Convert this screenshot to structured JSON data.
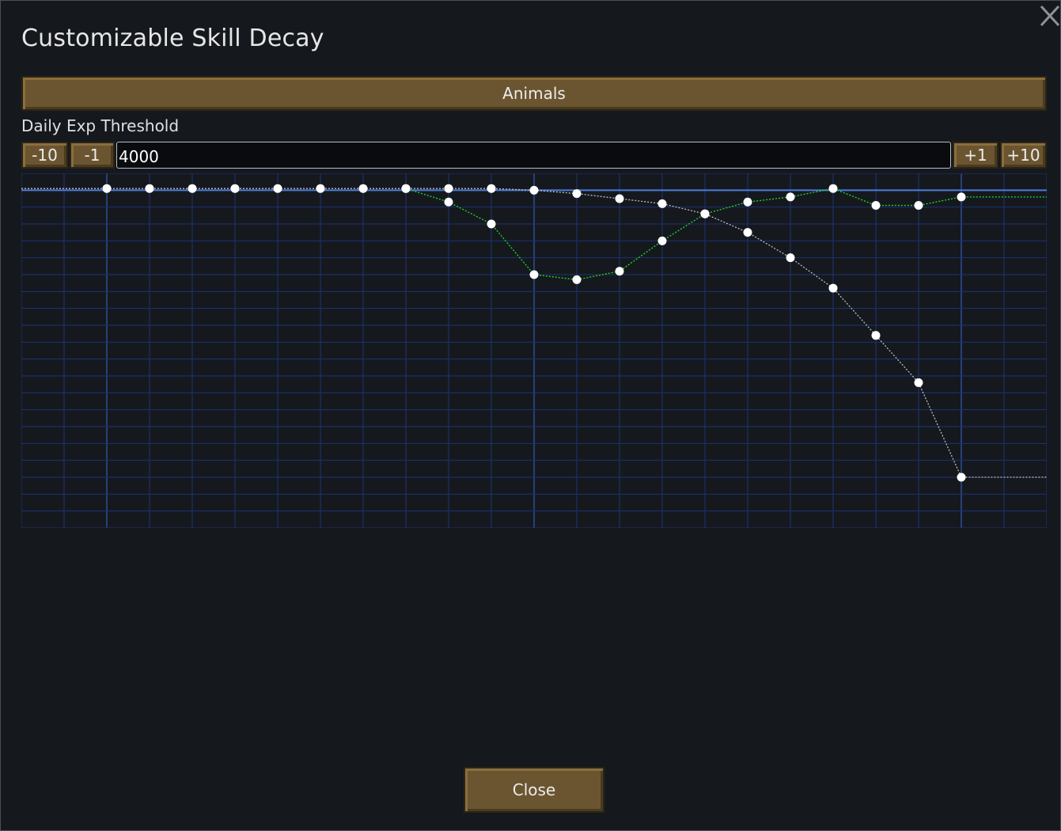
{
  "dialog": {
    "title": "Customizable Skill Decay",
    "close_icon": "close-x-icon"
  },
  "skill_selector": {
    "label": "Animals"
  },
  "threshold": {
    "label": "Daily Exp Threshold",
    "value": "4000",
    "buttons": {
      "minus10": "-10",
      "minus1": "-1",
      "plus1": "+1",
      "plus10": "+10"
    }
  },
  "footer": {
    "close_label": "Close"
  },
  "chart_data": {
    "type": "line",
    "grid": true,
    "xlim": [
      -2,
      22
    ],
    "ylim": [
      -20,
      1
    ],
    "x_major_lines": [
      0,
      10,
      20
    ],
    "reference_y": 0,
    "colors": {
      "grid": "#1e3275",
      "major": "#3454a8",
      "reference": "#4f7bdc",
      "series_decay": "#bdbdbd",
      "series_green": "#22dd22",
      "point": "#ffffff"
    },
    "series": [
      {
        "key": "decay",
        "points": [
          [
            0,
            0.1
          ],
          [
            1,
            0.1
          ],
          [
            2,
            0.1
          ],
          [
            3,
            0.1
          ],
          [
            4,
            0.1
          ],
          [
            5,
            0.1
          ],
          [
            6,
            0.1
          ],
          [
            7,
            0.1
          ],
          [
            8,
            0.1
          ],
          [
            9,
            0.1
          ],
          [
            10,
            0
          ],
          [
            11,
            -0.2
          ],
          [
            12,
            -0.5
          ],
          [
            13,
            -0.8
          ],
          [
            14,
            -1.4
          ],
          [
            15,
            -2.5
          ],
          [
            16,
            -4
          ],
          [
            17,
            -5.8
          ],
          [
            18,
            -8.6
          ],
          [
            19,
            -11.4
          ],
          [
            20,
            -17
          ]
        ],
        "extend_left": true,
        "extend_right": true
      },
      {
        "key": "green",
        "points": [
          [
            7,
            0.1
          ],
          [
            8,
            -0.7
          ],
          [
            9,
            -2
          ],
          [
            10,
            -5
          ],
          [
            11,
            -5.3
          ],
          [
            12,
            -4.8
          ],
          [
            13,
            -3
          ],
          [
            14,
            -1.4
          ],
          [
            15,
            -0.7
          ],
          [
            16,
            -0.4
          ],
          [
            17,
            0.1
          ],
          [
            18,
            -0.9
          ],
          [
            19,
            -0.9
          ],
          [
            20,
            -0.4
          ]
        ],
        "extend_left": false,
        "extend_right": true
      }
    ]
  }
}
